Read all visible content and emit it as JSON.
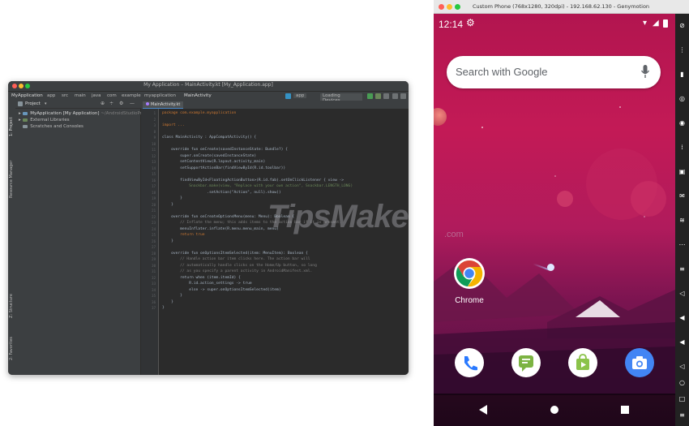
{
  "studio": {
    "window_title": "My Application – MainActivity.kt [My_Application.app]",
    "breadcrumbs": [
      "MyApplication",
      "app",
      "src",
      "main",
      "java",
      "com",
      "example",
      "myapplication",
      "MainActivity"
    ],
    "run_config": "app",
    "device_selector": "Loading Devices...",
    "left_strip_labels": [
      "1: Project",
      "Resource Manager",
      "Z: Structure",
      "2: Favorites",
      "Build Variants"
    ],
    "project_panel": {
      "header": "Project",
      "items": [
        {
          "label": "MyApplication [My Application]",
          "suffix": "~/AndroidStudioProjects/MyApplication"
        },
        {
          "label": "External Libraries",
          "suffix": ""
        },
        {
          "label": "Scratches and Consoles",
          "suffix": ""
        }
      ]
    },
    "editor_tab": "MainActivity.kt",
    "code_lines": [
      "package com.example.myapplication",
      "",
      "import ...",
      "",
      "class MainActivity : AppCompatActivity() {",
      "",
      "    override fun onCreate(savedInstanceState: Bundle?) {",
      "        super.onCreate(savedInstanceState)",
      "        setContentView(R.layout.activity_main)",
      "        setSupportActionBar(findViewById(R.id.toolbar))",
      "",
      "        findViewById<FloatingActionButton>(R.id.fab).setOnClickListener { view ->",
      "            Snackbar.make(view, \"Replace with your own action\", Snackbar.LENGTH_LONG)",
      "                    .setAction(\"Action\", null).show()",
      "        }",
      "    }",
      "",
      "    override fun onCreateOptionsMenu(menu: Menu): Boolean {",
      "        // Inflate the menu; this adds items to the action bar if it is present.",
      "        menuInflater.inflate(R.menu.menu_main, menu)",
      "        return true",
      "    }",
      "",
      "    override fun onOptionsItemSelected(item: MenuItem): Boolean {",
      "        // Handle action bar item clicks here. The action bar will",
      "        // automatically handle clicks on the Home/Up button, so long",
      "        // as you specify a parent activity in AndroidManifest.xml.",
      "        return when (item.itemId) {",
      "            R.id.action_settings -> true",
      "            else -> super.onOptionsItemSelected(item)",
      "        }",
      "    }",
      "}"
    ],
    "line_numbers": [
      "1",
      "2",
      "3",
      "8",
      "9",
      "10",
      "11",
      "12",
      "13",
      "14",
      "15",
      "16",
      "17",
      "18",
      "19",
      "20",
      "21",
      "22",
      "23",
      "24",
      "25",
      "26",
      "27",
      "28",
      "29",
      "30",
      "31",
      "32",
      "33",
      "34",
      "35",
      "36",
      "37"
    ]
  },
  "genymotion": {
    "window_title": "Custom Phone (768x1280, 320dpi) - 192.168.62.130 - Genymotion",
    "status_time": "12:14",
    "search_placeholder": "Search with Google",
    "home_app_label": "Chrome",
    "dock_apps": [
      "Phone",
      "Messages",
      "Play Store",
      "Camera"
    ],
    "sidebar_icons": [
      "power-icon",
      "volume-up-icon",
      "volume-down-icon",
      "rotate-icon",
      "gps-icon",
      "camera-icon",
      "id-icon",
      "phone-icon",
      "wifi-icon",
      "menu-icon",
      "share-icon",
      "back-icon",
      "home-icon",
      "recents-icon",
      "close-icon"
    ]
  },
  "watermark": {
    "text": "TipsMake",
    "suffix": ".com"
  },
  "colors": {
    "ide_background": "#2b2b2b",
    "ide_panel": "#3c3f41",
    "keyword": "#cc7832",
    "string": "#6a8759",
    "phone_wallpaper_top": "#b2154f",
    "phone_wallpaper_bottom": "#45113a"
  }
}
